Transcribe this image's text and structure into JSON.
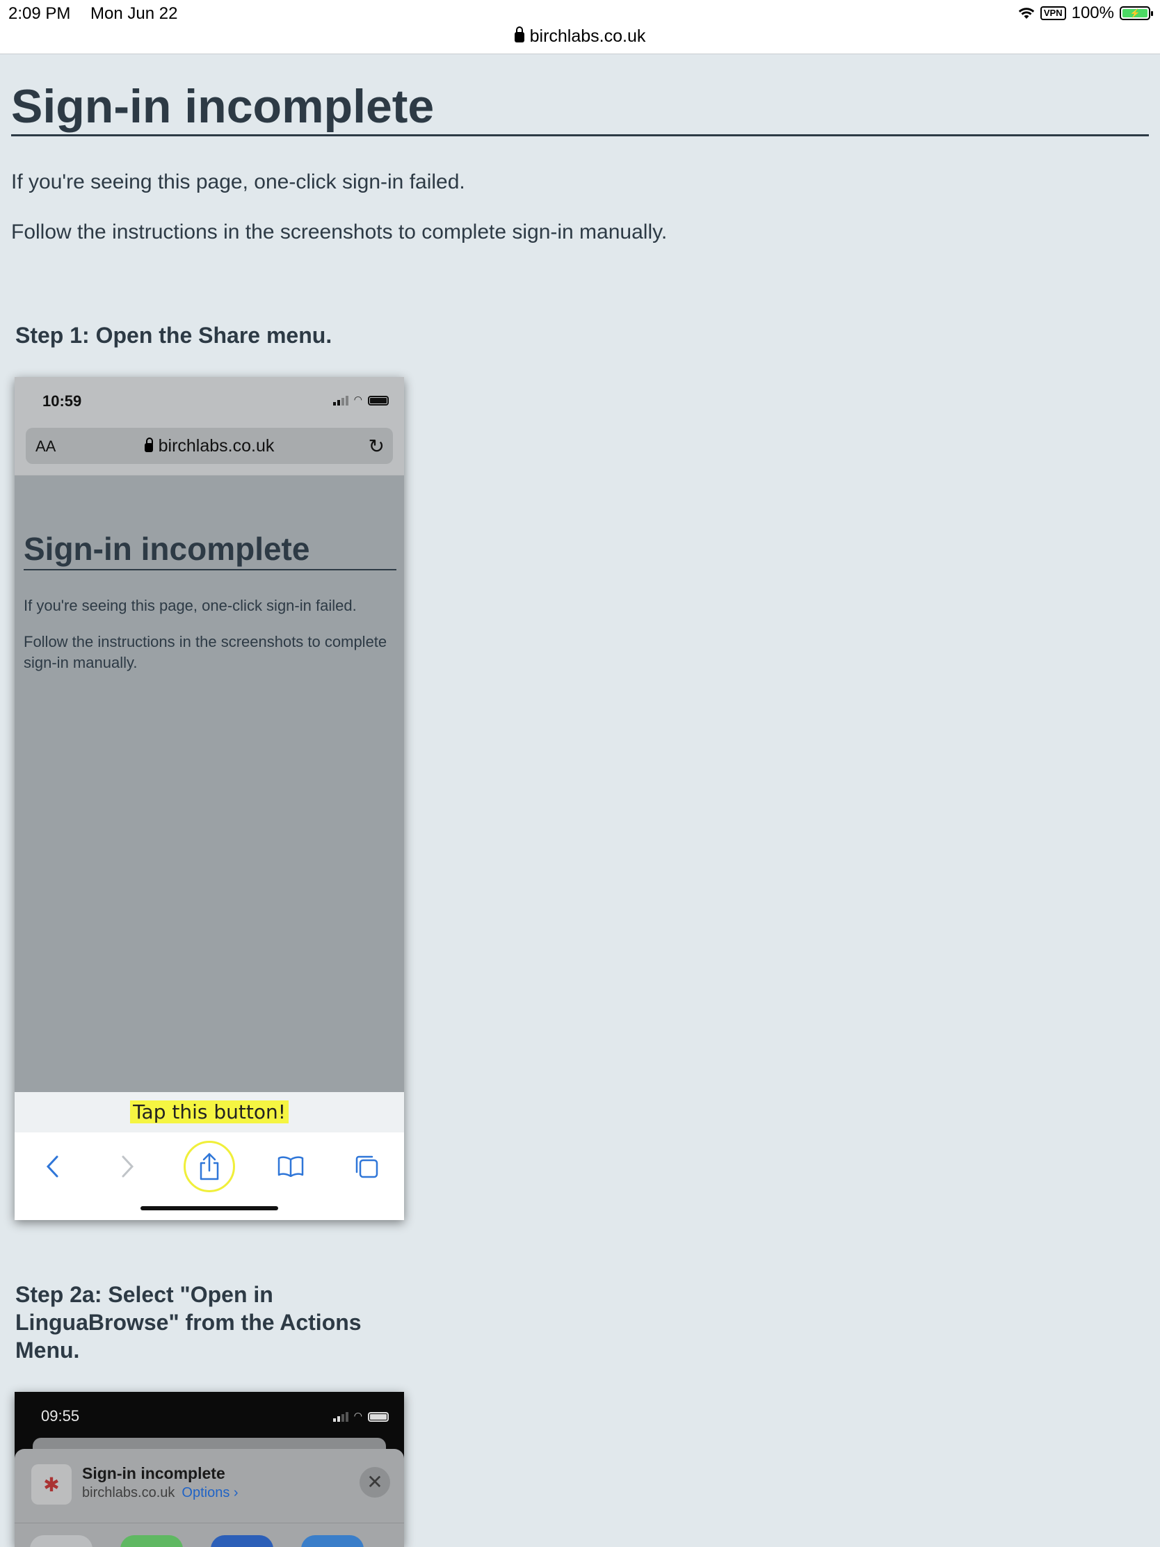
{
  "statusbar": {
    "time": "2:09 PM",
    "date": "Mon Jun 22",
    "vpn": "VPN",
    "battery": "100%",
    "url": "birchlabs.co.uk"
  },
  "page": {
    "title": "Sign-in incomplete",
    "para1": "If you're seeing this page, one-click sign-in failed.",
    "para2": "Follow the instructions in the screenshots to complete sign-in manually."
  },
  "step1": {
    "heading": "Step 1: Open the Share menu.",
    "screenshot": {
      "time": "10:59",
      "aa": "AA",
      "url": "birchlabs.co.uk",
      "title": "Sign-in incomplete",
      "para1": "If you're seeing this page, one-click sign-in failed.",
      "para2": "Follow the instructions in the screenshots to complete sign-in manually.",
      "tip": "Tap this button!",
      "toolbar_icons": [
        "back-icon",
        "forward-icon",
        "share-icon",
        "bookmarks-icon",
        "tabs-icon"
      ]
    }
  },
  "step2a": {
    "heading": "Step 2a: Select \"Open in LinguaBrowse\" from the Actions Menu.",
    "screenshot": {
      "time": "09:55",
      "title": "Sign-in incomplete",
      "domain": "birchlabs.co.uk",
      "options": "Options ›",
      "close": "✕"
    }
  },
  "colors": {
    "background": "#e1e8ec",
    "text": "#2d3a45",
    "highlight": "#f5f542",
    "ios_blue": "#2f76d8"
  }
}
